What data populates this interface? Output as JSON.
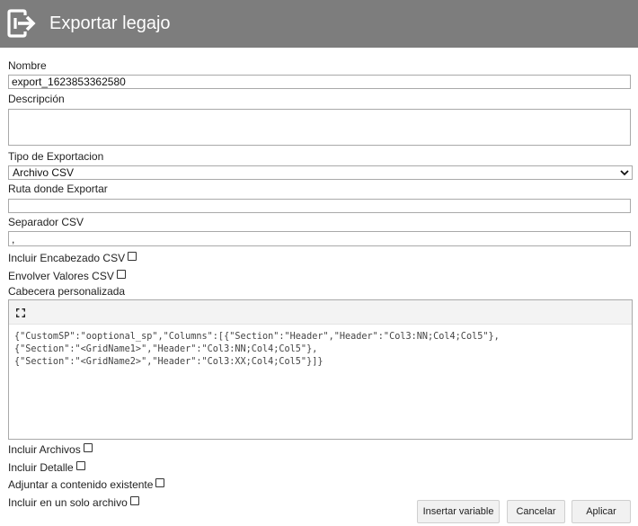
{
  "header": {
    "title": "Exportar legajo",
    "logo_icon": "export-icon"
  },
  "form": {
    "nombre": {
      "label": "Nombre",
      "value": "export_1623853362580"
    },
    "descripcion": {
      "label": "Descripción",
      "value": ""
    },
    "tipo": {
      "label": "Tipo de Exportacion",
      "selected": "Archivo CSV"
    },
    "ruta": {
      "label": "Ruta donde Exportar",
      "value": ""
    },
    "separador": {
      "label": "Separador CSV",
      "value": ","
    },
    "incluir_encabezado": {
      "label": "Incluir Encabezado CSV",
      "checked": false
    },
    "envolver_valores": {
      "label": "Envolver Valores CSV",
      "checked": false
    },
    "cabecera": {
      "label": "Cabecera personalizada",
      "code": "{\"CustomSP\":\"ooptional_sp\",\"Columns\":[{\"Section\":\"Header\",\"Header\":\"Col3:NN;Col4;Col5\"},\n{\"Section\":\"<GridName1>\",\"Header\":\"Col3:NN;Col4;Col5\"},\n{\"Section\":\"<GridName2>\",\"Header\":\"Col3:XX;Col4;Col5\"}]}"
    },
    "incluir_archivos": {
      "label": "Incluir Archivos",
      "checked": false
    },
    "incluir_detalle": {
      "label": "Incluir Detalle",
      "checked": false
    },
    "adjuntar": {
      "label": "Adjuntar a contenido existente",
      "checked": false
    },
    "un_solo_archivo": {
      "label": "Incluir en un solo archivo",
      "checked": false
    }
  },
  "buttons": {
    "insertar_variable": "Insertar variable",
    "cancelar": "Cancelar",
    "aplicar": "Aplicar"
  },
  "colors": {
    "header_bg": "#7d7d7d",
    "header_text": "#ffffff"
  }
}
